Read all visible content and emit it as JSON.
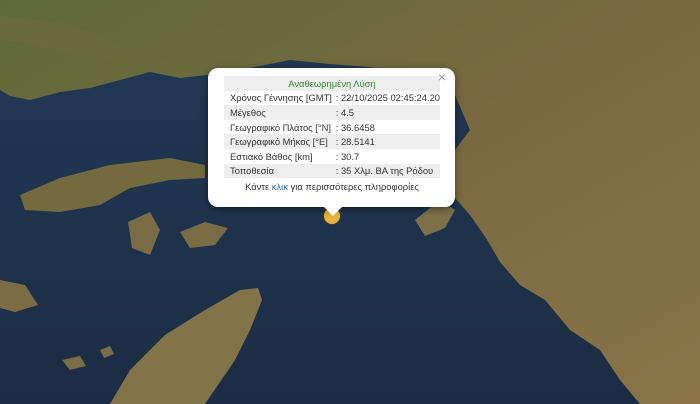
{
  "popup": {
    "title": "Αναθεωρημένη Λύση",
    "close_symbol": "×",
    "rows": [
      {
        "label": "Χρόνος Γέννησης [GMT]",
        "value": ": 22/10/2025 02:45:24.20"
      },
      {
        "label": "Μέγεθος",
        "value": ": 4.5"
      },
      {
        "label": "Γεωγραφικό Πλάτος [°N]",
        "value": ": 36.6458"
      },
      {
        "label": "Γεωγραφικό Μήκος [°E]",
        "value": ": 28.5141"
      },
      {
        "label": "Εστιακό Βάθος [km]",
        "value": ": 30.7"
      },
      {
        "label": "Τοποθεσία",
        "value": ": 35 Χλμ. ΒΑ της Ρόδου"
      }
    ],
    "more_prefix": "Κάντε ",
    "more_link": "κλικ",
    "more_suffix": " για περισσότερες πληροφορίες"
  },
  "colors": {
    "sea": "#1d3148",
    "land": "#6e6a3e",
    "marker": "#e3b53b",
    "title": "#2e8b2e",
    "link": "#2a6fc9"
  },
  "icons": {
    "close": "close-icon",
    "marker": "earthquake-marker"
  }
}
